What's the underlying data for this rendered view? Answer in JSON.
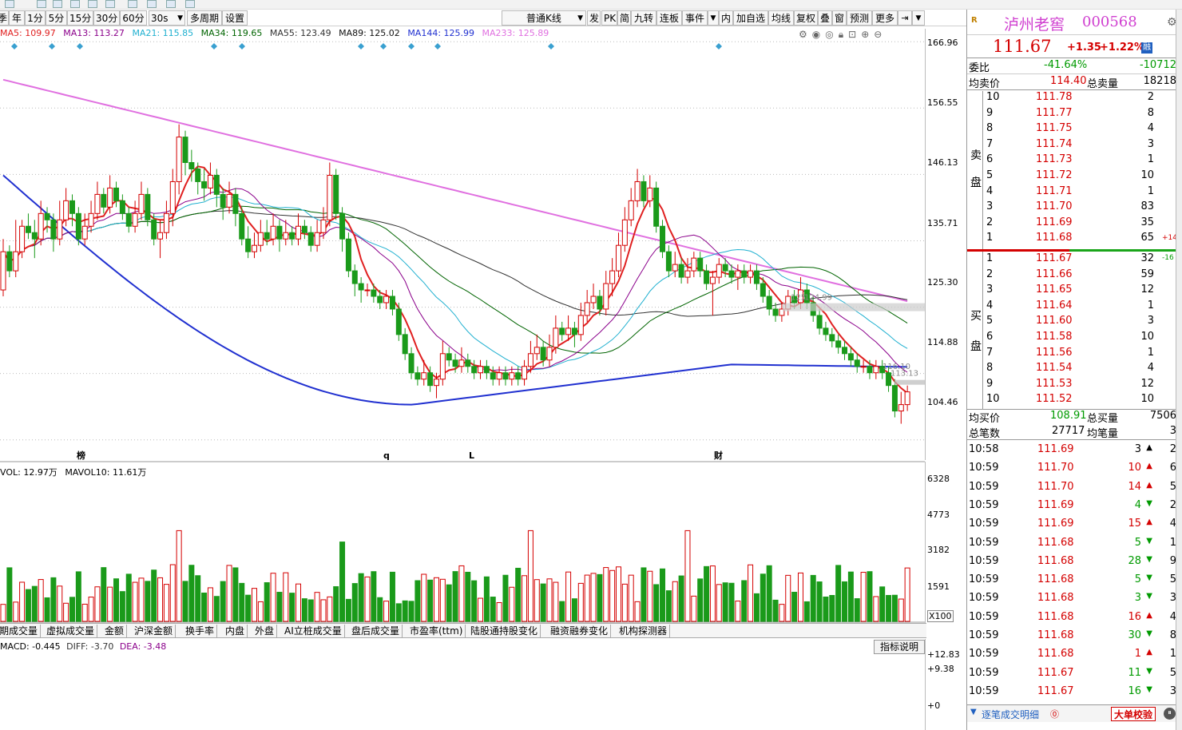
{
  "toolbar": {
    "items": [
      "季",
      "年",
      "1分",
      "5分",
      "15分",
      "30分",
      "60分",
      "30s",
      "多周期",
      "设置",
      "普通K线",
      "发",
      "PK",
      "简",
      "九转",
      "连板",
      "事件",
      "内",
      "加自选",
      "均线",
      "复权",
      "叠",
      "窗",
      "预测",
      "更多"
    ]
  },
  "legend": {
    "ma5": "MA5: 109.97",
    "ma13": "MA13: 113.27",
    "ma21": "MA21: 115.85",
    "ma34": "MA34: 119.65",
    "ma55": "MA55: 123.49",
    "ma89": "MA89: 125.02",
    "ma144": "MA144: 125.99",
    "ma233": "MA233: 125.89",
    "colors": {
      "ma5": "#e02020",
      "ma13": "#8b008b",
      "ma21": "#20b0d0",
      "ma34": "#006400",
      "ma55": "#333333",
      "ma89": "#111111",
      "ma144": "#2030d0",
      "ma233": "#e070e0"
    }
  },
  "price_axis": [
    "166.96",
    "156.55",
    "146.13",
    "135.71",
    "125.30",
    "114.88",
    "104.46"
  ],
  "price_marks": [
    "125.",
    "124.99",
    "116.10",
    "113.13"
  ],
  "chart_markers": [
    "榜",
    "q",
    "L",
    "财"
  ],
  "volume": {
    "legend_a": "VOL: 12.97万",
    "legend_b": "MAVOL10: 11.61万",
    "axis": [
      "6328",
      "4773",
      "3182",
      "1591"
    ],
    "unit": "X100"
  },
  "indicator_tabs": [
    "期成交量",
    "虚拟成交量",
    "金额",
    "沪深金额",
    "换手率",
    "内盘",
    "外盘",
    "AI立桩成交量",
    "盘后成交量",
    "市盈率(ttm)",
    "陆股通持股变化",
    "融资融券变化",
    "机构探测器"
  ],
  "macd": {
    "legend_a": "MACD: -0.445",
    "legend_b": "DIFF: -3.70",
    "legend_c": "DEA: -3.48",
    "axis": [
      "+12.83",
      "+9.38",
      "+0"
    ],
    "help_label": "指标说明"
  },
  "quote": {
    "name": "泸州老窖",
    "code": "000568",
    "price": "111.67",
    "change": "+1.35",
    "pct": "+1.22%",
    "tag": "融",
    "weibi_label": "委比",
    "weibi_pct": "-41.64%",
    "weibi_val": "-10712",
    "avg_sell_label": "均卖价",
    "avg_sell": "114.40",
    "total_sell_label": "总卖量",
    "total_sell": "18218",
    "sell_label_a": "卖",
    "sell_label_b": "盘",
    "buy_label_a": "买",
    "buy_label_b": "盘",
    "sell_extra": "+14",
    "buy_extra": "-16",
    "asks": [
      {
        "lvl": "10",
        "price": "111.78",
        "vol": "2"
      },
      {
        "lvl": "9",
        "price": "111.77",
        "vol": "8"
      },
      {
        "lvl": "8",
        "price": "111.75",
        "vol": "4"
      },
      {
        "lvl": "7",
        "price": "111.74",
        "vol": "3"
      },
      {
        "lvl": "6",
        "price": "111.73",
        "vol": "1"
      },
      {
        "lvl": "5",
        "price": "111.72",
        "vol": "10"
      },
      {
        "lvl": "4",
        "price": "111.71",
        "vol": "1"
      },
      {
        "lvl": "3",
        "price": "111.70",
        "vol": "83"
      },
      {
        "lvl": "2",
        "price": "111.69",
        "vol": "35"
      },
      {
        "lvl": "1",
        "price": "111.68",
        "vol": "65"
      }
    ],
    "bids": [
      {
        "lvl": "1",
        "price": "111.67",
        "vol": "32"
      },
      {
        "lvl": "2",
        "price": "111.66",
        "vol": "59"
      },
      {
        "lvl": "3",
        "price": "111.65",
        "vol": "12"
      },
      {
        "lvl": "4",
        "price": "111.64",
        "vol": "1"
      },
      {
        "lvl": "5",
        "price": "111.60",
        "vol": "3"
      },
      {
        "lvl": "6",
        "price": "111.58",
        "vol": "10"
      },
      {
        "lvl": "7",
        "price": "111.56",
        "vol": "1"
      },
      {
        "lvl": "8",
        "price": "111.54",
        "vol": "4"
      },
      {
        "lvl": "9",
        "price": "111.53",
        "vol": "12"
      },
      {
        "lvl": "10",
        "price": "111.52",
        "vol": "10"
      }
    ],
    "avg_buy_label": "均买价",
    "avg_buy": "108.91",
    "total_buy_label": "总买量",
    "total_buy": "7506",
    "total_trades_label": "总笔数",
    "total_trades": "27717",
    "avg_per_label": "均笔量",
    "avg_per": "3"
  },
  "trades": [
    {
      "t": "10:58",
      "p": "111.69",
      "v": "3",
      "dir": "up",
      "c": "black",
      "n": "2"
    },
    {
      "t": "10:59",
      "p": "111.70",
      "v": "10",
      "dir": "up",
      "c": "red",
      "n": "6"
    },
    {
      "t": "10:59",
      "p": "111.70",
      "v": "14",
      "dir": "up",
      "c": "red",
      "n": "5"
    },
    {
      "t": "10:59",
      "p": "111.69",
      "v": "4",
      "dir": "down",
      "c": "green",
      "n": "2"
    },
    {
      "t": "10:59",
      "p": "111.69",
      "v": "15",
      "dir": "up",
      "c": "red",
      "n": "4"
    },
    {
      "t": "10:59",
      "p": "111.68",
      "v": "5",
      "dir": "down",
      "c": "green",
      "n": "1"
    },
    {
      "t": "10:59",
      "p": "111.68",
      "v": "28",
      "dir": "down",
      "c": "green",
      "n": "9"
    },
    {
      "t": "10:59",
      "p": "111.68",
      "v": "5",
      "dir": "down",
      "c": "green",
      "n": "5"
    },
    {
      "t": "10:59",
      "p": "111.68",
      "v": "3",
      "dir": "down",
      "c": "green",
      "n": "3"
    },
    {
      "t": "10:59",
      "p": "111.68",
      "v": "16",
      "dir": "up",
      "c": "red",
      "n": "4"
    },
    {
      "t": "10:59",
      "p": "111.68",
      "v": "30",
      "dir": "down",
      "c": "green",
      "n": "8"
    },
    {
      "t": "10:59",
      "p": "111.68",
      "v": "1",
      "dir": "up",
      "c": "red",
      "n": "1"
    },
    {
      "t": "10:59",
      "p": "111.67",
      "v": "11",
      "dir": "down",
      "c": "green",
      "n": "5"
    },
    {
      "t": "10:59",
      "p": "111.67",
      "v": "16",
      "dir": "down",
      "c": "green",
      "n": "3"
    }
  ],
  "bottom": {
    "detail_label": "逐笔成交明细",
    "big_order_label": "大单校验"
  },
  "chart_data": {
    "type": "candlestick",
    "ylim": [
      101.3,
      169.0
    ],
    "candles": [
      [
        128,
        134,
        136,
        127
      ],
      [
        134,
        131,
        135,
        130
      ],
      [
        131,
        134,
        139,
        130
      ],
      [
        134,
        138,
        139,
        133
      ],
      [
        138,
        137,
        140,
        136
      ],
      [
        137,
        136,
        139,
        133
      ],
      [
        136,
        140,
        142,
        135
      ],
      [
        140,
        139,
        141,
        137
      ],
      [
        139,
        136,
        140,
        134
      ],
      [
        136,
        139,
        142,
        135
      ],
      [
        139,
        142,
        144,
        138
      ],
      [
        142,
        140,
        143,
        138
      ],
      [
        140,
        136,
        141,
        135
      ],
      [
        136,
        138,
        140,
        135
      ],
      [
        138,
        140,
        142,
        137
      ],
      [
        140,
        143,
        145,
        139
      ],
      [
        143,
        141,
        144,
        140
      ],
      [
        141,
        144,
        146,
        140
      ],
      [
        144,
        142,
        145,
        141
      ],
      [
        142,
        140,
        143,
        139
      ],
      [
        140,
        138,
        141,
        137
      ],
      [
        138,
        140,
        142,
        137
      ],
      [
        140,
        143,
        145,
        139
      ],
      [
        143,
        139,
        144,
        138
      ],
      [
        139,
        136,
        140,
        135
      ],
      [
        136,
        137,
        139,
        133
      ],
      [
        137,
        140,
        142,
        136
      ],
      [
        140,
        145,
        147,
        138
      ],
      [
        145,
        152,
        154,
        143
      ],
      [
        152,
        148,
        153,
        146
      ],
      [
        148,
        147,
        150,
        145
      ],
      [
        147,
        145,
        148,
        143
      ],
      [
        145,
        144,
        147,
        142
      ],
      [
        144,
        146,
        148,
        143
      ],
      [
        146,
        143,
        147,
        141
      ],
      [
        143,
        141,
        144,
        139
      ],
      [
        141,
        143,
        145,
        140
      ],
      [
        143,
        140,
        144,
        138
      ],
      [
        140,
        136,
        141,
        135
      ],
      [
        136,
        134,
        138,
        133
      ],
      [
        134,
        135,
        137,
        133
      ],
      [
        135,
        137,
        139,
        134
      ],
      [
        137,
        136,
        139,
        135
      ],
      [
        136,
        138,
        140,
        135
      ],
      [
        138,
        136,
        139,
        134
      ],
      [
        136,
        137,
        139,
        135
      ],
      [
        137,
        136,
        138,
        135
      ],
      [
        136,
        138,
        140,
        135
      ],
      [
        138,
        137,
        139,
        136
      ],
      [
        137,
        135,
        138,
        134
      ],
      [
        135,
        137,
        139,
        134
      ],
      [
        137,
        139,
        141,
        136
      ],
      [
        139,
        146,
        148,
        138
      ],
      [
        146,
        140,
        147,
        139
      ],
      [
        140,
        136,
        141,
        134
      ],
      [
        136,
        131,
        137,
        130
      ],
      [
        131,
        129,
        132,
        127
      ],
      [
        129,
        128,
        130,
        126
      ],
      [
        128,
        128,
        129,
        127
      ],
      [
        128,
        127,
        129,
        126
      ],
      [
        127,
        126,
        128,
        125
      ],
      [
        126,
        127,
        128,
        125
      ],
      [
        127,
        125,
        128,
        124
      ],
      [
        125,
        121,
        126,
        120
      ],
      [
        121,
        118,
        122,
        117
      ],
      [
        118,
        115,
        119,
        114
      ],
      [
        115,
        114,
        116,
        113
      ],
      [
        114,
        115,
        117,
        113
      ],
      [
        115,
        113,
        116,
        112
      ],
      [
        113,
        114,
        115,
        111
      ],
      [
        114,
        118,
        120,
        113
      ],
      [
        118,
        117,
        119,
        116
      ],
      [
        117,
        116,
        118,
        115
      ],
      [
        116,
        117,
        119,
        115
      ],
      [
        117,
        116,
        118,
        115
      ],
      [
        116,
        115,
        117,
        114
      ],
      [
        115,
        116,
        117,
        114
      ],
      [
        116,
        115,
        117,
        114
      ],
      [
        115,
        114,
        116,
        113
      ],
      [
        114,
        115,
        116,
        113
      ],
      [
        115,
        114,
        116,
        113
      ],
      [
        114,
        115,
        116,
        113
      ],
      [
        115,
        114,
        116,
        113
      ],
      [
        114,
        116,
        117,
        113
      ],
      [
        116,
        118,
        120,
        115
      ],
      [
        118,
        119,
        121,
        117
      ],
      [
        119,
        117,
        120,
        116
      ],
      [
        117,
        119,
        121,
        116
      ],
      [
        119,
        122,
        124,
        118
      ],
      [
        122,
        121,
        123,
        120
      ],
      [
        121,
        122,
        124,
        120
      ],
      [
        122,
        121,
        123,
        119
      ],
      [
        121,
        124,
        126,
        120
      ],
      [
        124,
        126,
        128,
        123
      ],
      [
        126,
        127,
        129,
        125
      ],
      [
        127,
        125,
        128,
        124
      ],
      [
        125,
        129,
        131,
        124
      ],
      [
        129,
        131,
        133,
        127
      ],
      [
        131,
        135,
        137,
        130
      ],
      [
        135,
        139,
        141,
        134
      ],
      [
        139,
        142,
        144,
        138
      ],
      [
        142,
        145,
        147,
        141
      ],
      [
        145,
        142,
        146,
        141
      ],
      [
        142,
        144,
        146,
        141
      ],
      [
        144,
        138,
        145,
        137
      ],
      [
        138,
        134,
        139,
        133
      ],
      [
        134,
        131,
        135,
        130
      ],
      [
        131,
        132,
        134,
        130
      ],
      [
        132,
        130,
        133,
        129
      ],
      [
        130,
        131,
        133,
        129
      ],
      [
        131,
        133,
        134,
        130
      ],
      [
        133,
        131,
        134,
        130
      ],
      [
        131,
        129,
        132,
        128
      ],
      [
        129,
        130,
        131,
        124
      ],
      [
        130,
        132,
        133,
        129
      ],
      [
        132,
        131,
        133,
        130
      ],
      [
        131,
        130,
        132,
        129
      ],
      [
        130,
        131,
        132,
        128
      ],
      [
        131,
        130,
        132,
        129
      ],
      [
        130,
        131,
        132,
        129
      ],
      [
        131,
        129,
        132,
        128
      ],
      [
        129,
        127,
        130,
        126
      ],
      [
        127,
        125,
        128,
        124
      ],
      [
        125,
        124,
        126,
        123
      ],
      [
        124,
        125,
        126,
        123
      ],
      [
        125,
        127,
        128,
        124
      ],
      [
        127,
        126,
        128,
        125
      ],
      [
        126,
        128,
        130,
        125
      ],
      [
        128,
        126,
        129,
        125
      ],
      [
        126,
        124,
        127,
        123
      ],
      [
        124,
        122,
        125,
        121
      ],
      [
        122,
        121,
        123,
        120
      ],
      [
        121,
        120,
        122,
        119
      ],
      [
        120,
        119,
        121,
        118
      ],
      [
        119,
        118,
        120,
        117
      ],
      [
        118,
        117,
        119,
        116
      ],
      [
        117,
        116,
        118,
        115
      ],
      [
        116,
        116,
        117,
        115
      ],
      [
        116,
        115,
        117,
        114
      ],
      [
        115,
        116,
        117,
        114
      ],
      [
        116,
        115,
        117,
        114
      ],
      [
        115,
        113,
        116,
        112
      ],
      [
        113,
        109,
        114,
        108
      ],
      [
        109,
        110,
        112,
        107
      ],
      [
        110,
        112,
        113,
        109
      ]
    ]
  }
}
